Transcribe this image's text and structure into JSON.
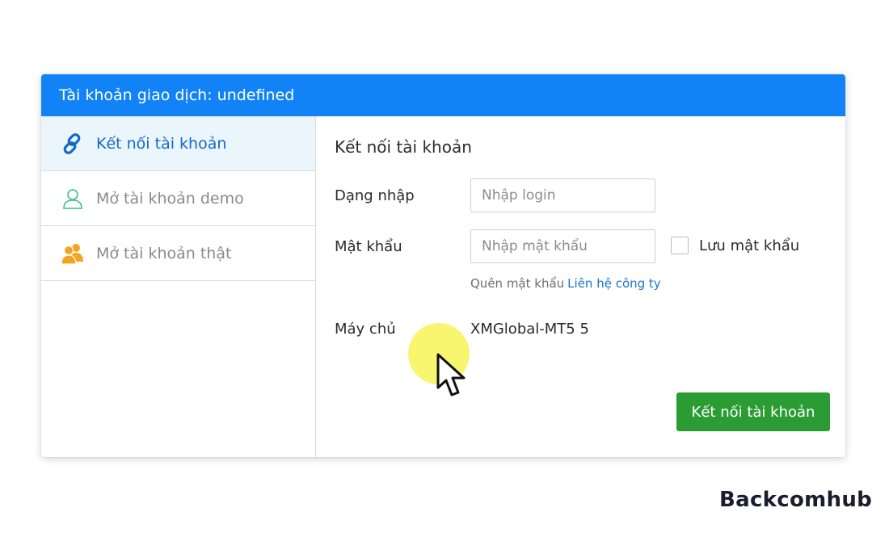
{
  "header": {
    "title": "Tài khoản giao dịch: undefined",
    "color": "#1283f7"
  },
  "sidebar": {
    "items": [
      {
        "label": "Kết nối tài khoản",
        "icon": "link-icon",
        "active": true
      },
      {
        "label": "Mở tài khoản demo",
        "icon": "user-outline-icon",
        "active": false
      },
      {
        "label": "Mở tài khoản thật",
        "icon": "users-filled-icon",
        "active": false
      }
    ]
  },
  "form": {
    "title": "Kết nối tài khoản",
    "login": {
      "label": "Dạng nhập",
      "value": "",
      "placeholder": "Nhập login"
    },
    "password": {
      "label": "Mật khẩu",
      "value": "",
      "placeholder": "Nhập mật khẩu"
    },
    "remember": {
      "label": "Lưu mật khẩu",
      "checked": false
    },
    "forgot": {
      "text": "Quên mật khẩu",
      "link": "Liên hệ công ty"
    },
    "server": {
      "label": "Máy chủ",
      "value": "XMGlobal-MT5 5"
    },
    "submit_label": "Kết nối tài khoản",
    "submit_color": "#2b9c34"
  },
  "watermark": {
    "text": "Backcomhub"
  }
}
